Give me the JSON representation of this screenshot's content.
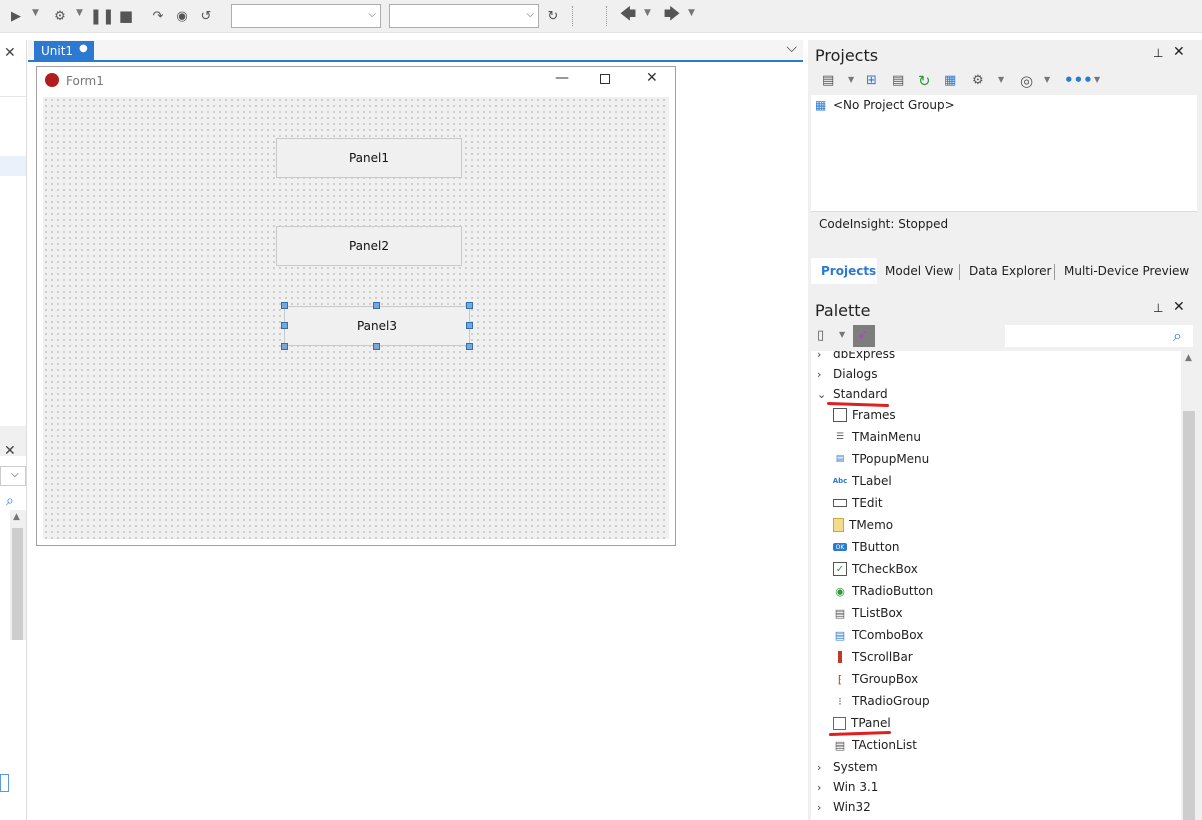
{
  "tabs": {
    "unit_tab": "Unit1"
  },
  "form": {
    "title": "Form1"
  },
  "panels": {
    "panel1": "Panel1",
    "panel2": "Panel2",
    "panel3": "Panel3"
  },
  "projects": {
    "title": "Projects",
    "no_group": "<No Project Group>",
    "codeinsight": "CodeInsight: Stopped",
    "tabs": [
      "Projects",
      "Model View",
      "Data Explorer",
      "Multi-Device Preview"
    ]
  },
  "palette": {
    "title": "Palette",
    "categories": {
      "dbexpress": "dbExpress",
      "dialogs": "Dialogs",
      "standard": "Standard",
      "system": "System",
      "win31": "Win 3.1",
      "win32": "Win32"
    },
    "standard_items": [
      "Frames",
      "TMainMenu",
      "TPopupMenu",
      "TLabel",
      "TEdit",
      "TMemo",
      "TButton",
      "TCheckBox",
      "TRadioButton",
      "TListBox",
      "TComboBox",
      "TScrollBar",
      "TGroupBox",
      "TRadioGroup",
      "TPanel",
      "TActionList"
    ],
    "label_icon": "Abc",
    "button_icon": "OK"
  },
  "annotation_color": "#e02020",
  "accent": "#2b79d0"
}
